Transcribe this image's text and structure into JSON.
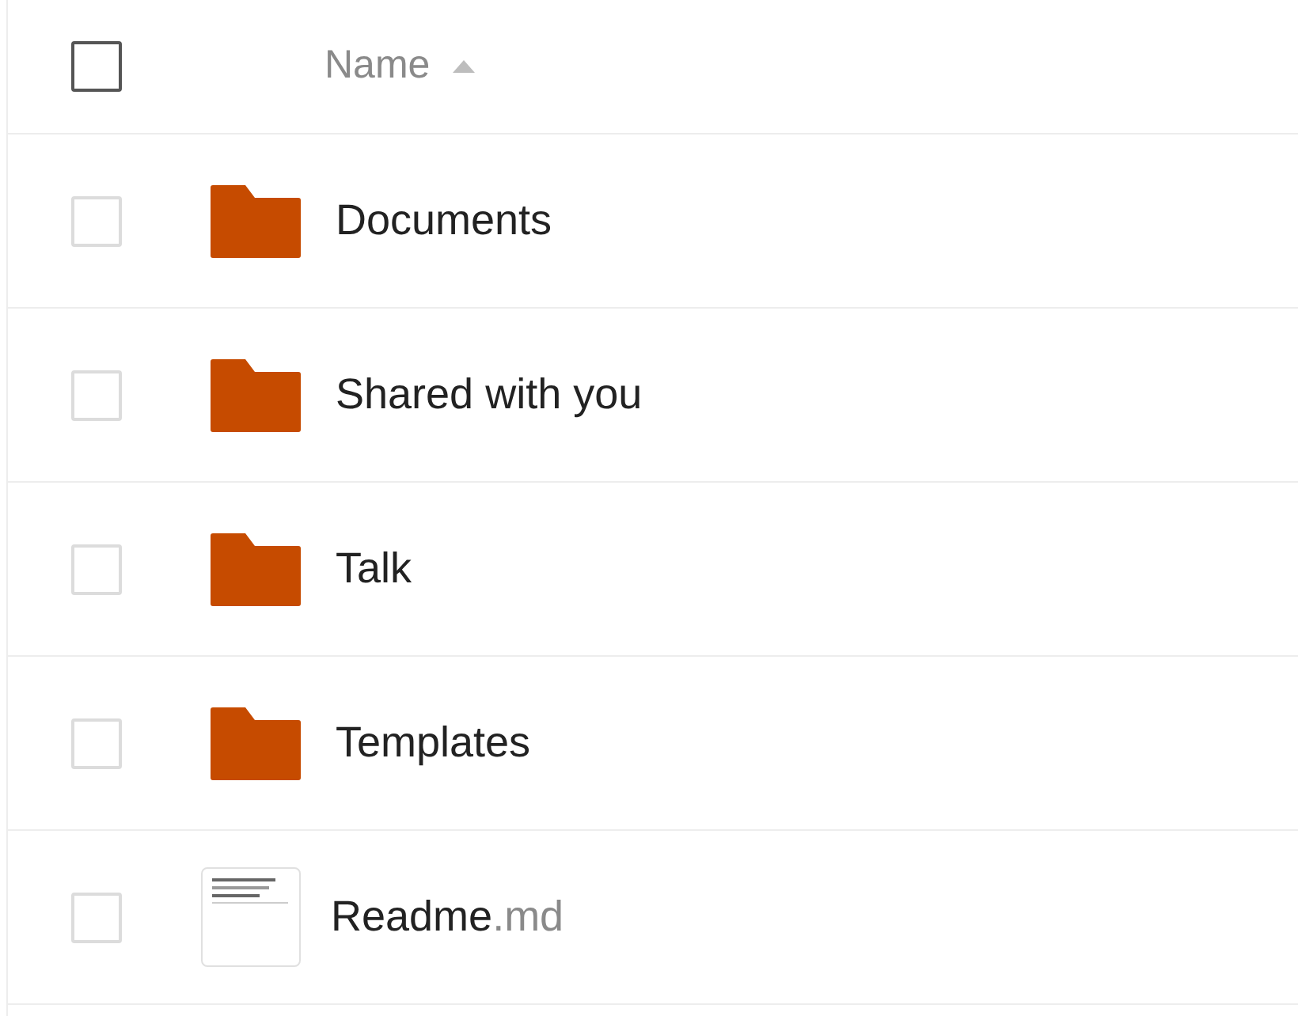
{
  "header": {
    "select_all": {
      "checked": false
    },
    "column": "Name",
    "sort_ascending": true
  },
  "rows": [
    {
      "kind": "folder",
      "name": "Documents",
      "checked": false
    },
    {
      "kind": "folder",
      "name": "Shared with you",
      "checked": false
    },
    {
      "kind": "folder",
      "name": "Talk",
      "checked": false
    },
    {
      "kind": "folder",
      "name": "Templates",
      "checked": false
    },
    {
      "kind": "file",
      "name": "Readme",
      "extension": ".md",
      "checked": false
    }
  ]
}
